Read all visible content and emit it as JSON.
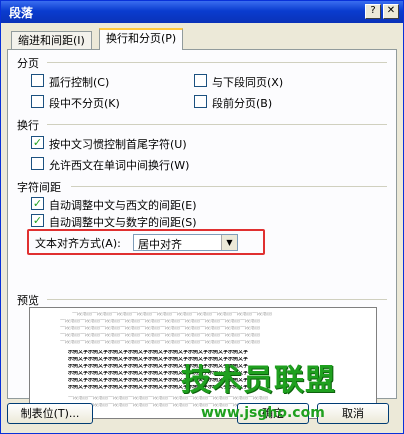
{
  "window": {
    "title": "段落"
  },
  "tabs": [
    {
      "label": "缩进和间距(I)"
    },
    {
      "label": "换行和分页(P)"
    }
  ],
  "pagination": {
    "header": "分页",
    "options": [
      {
        "label": "孤行控制(C)",
        "checked": false
      },
      {
        "label": "与下段同页(X)",
        "checked": false
      },
      {
        "label": "段中不分页(K)",
        "checked": false
      },
      {
        "label": "段前分页(B)",
        "checked": false
      }
    ]
  },
  "line_break": {
    "header": "换行",
    "options": [
      {
        "label": "按中文习惯控制首尾字符(U)",
        "checked": true
      },
      {
        "label": "允许西文在单词中间换行(W)",
        "checked": false
      }
    ]
  },
  "char_spacing": {
    "header": "字符间距",
    "options": [
      {
        "label": "自动调整中文与西文的间距(E)",
        "checked": true
      },
      {
        "label": "自动调整中文与数字的间距(S)",
        "checked": true
      }
    ],
    "align_label": "文本对齐方式(A):",
    "align_value": "居中对齐"
  },
  "preview": {
    "header": "预览",
    "sample_light": "一段落前一段落前一段落前一段落前一段落前一段落前一段落前一段落前一段落前一段落前",
    "sample_dark": "示例文字示例文字示例文字示例文字示例文字示例文字示例文字示例文字示例文字"
  },
  "buttons": {
    "tabs_btn": "制表位(T)...",
    "ok": "确定",
    "cancel": "取消"
  },
  "watermark": {
    "brand": "技术员联盟",
    "url": "www.jsgho.com"
  },
  "icons": {
    "help": "question-icon",
    "close": "close-icon",
    "check": "checkmark-icon",
    "dropdown": "triangle-down-icon"
  }
}
